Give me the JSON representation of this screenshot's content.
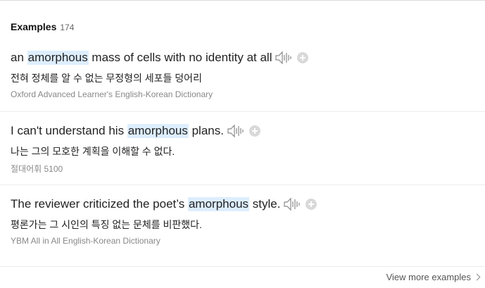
{
  "header": {
    "title": "Examples",
    "count": "174"
  },
  "examples": [
    {
      "before": "an ",
      "highlight": "amorphous",
      "after": " mass of cells with no identity at all",
      "translation": "전혀 정체를 알 수 없는 무정형의 세포들 덩어리",
      "source": "Oxford Advanced Learner's English-Korean Dictionary"
    },
    {
      "before": "I can't understand his ",
      "highlight": "amorphous",
      "after": " plans.",
      "translation": "나는 그의 모호한 계획을 이해할 수 없다.",
      "source": "절대어휘 5100"
    },
    {
      "before": "The reviewer criticized the poet’s ",
      "highlight": "amorphous",
      "after": " style.",
      "translation": "평론가는 그 시인의 특징 없는 문체를 비판했다.",
      "source": "YBM All in All English-Korean Dictionary"
    }
  ],
  "footer": {
    "view_more": "View more examples"
  },
  "icons": {
    "speaker": "speaker-icon",
    "add": "plus-circle-icon",
    "chevron": "chevron-right-icon"
  },
  "colors": {
    "highlight": "#ddeeff",
    "source_text": "#888888",
    "divider": "#ececec"
  }
}
